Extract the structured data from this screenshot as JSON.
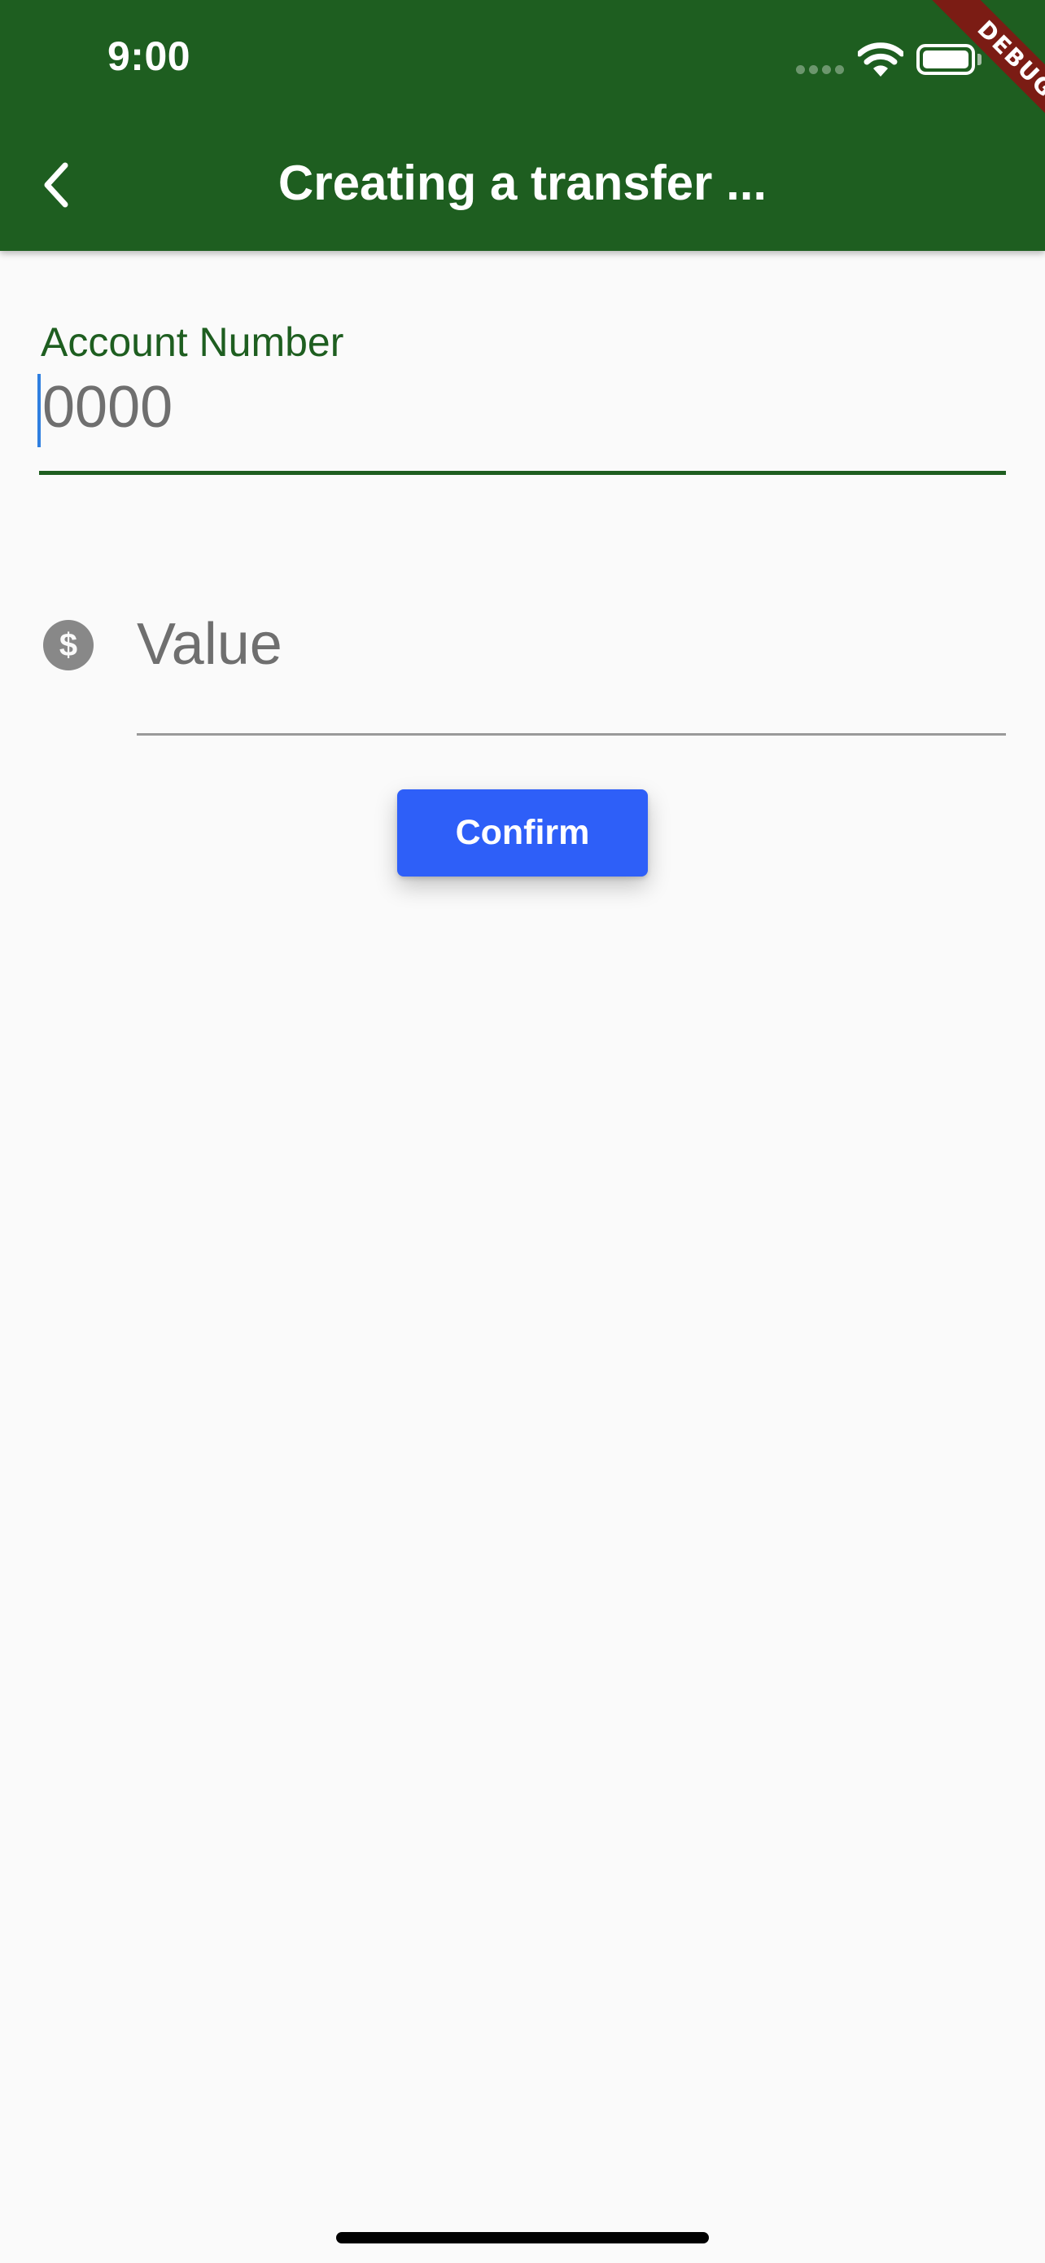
{
  "status_bar": {
    "time": "9:00",
    "icons": [
      "cellular-signal-icon",
      "wifi-icon",
      "battery-icon"
    ]
  },
  "app_bar": {
    "title": "Creating a transfer ...",
    "back_icon": "chevron-left-icon",
    "background_color": "#1e5e20",
    "debug_banner": "DEBUG"
  },
  "form": {
    "account_number": {
      "label": "Account Number",
      "placeholder": "0000",
      "value": ""
    },
    "value": {
      "icon": "dollar-circle-icon",
      "placeholder": "Value",
      "value": ""
    },
    "confirm_label": "Confirm",
    "accent_color": "#1e5e20",
    "button_color": "#2e5ff8"
  }
}
